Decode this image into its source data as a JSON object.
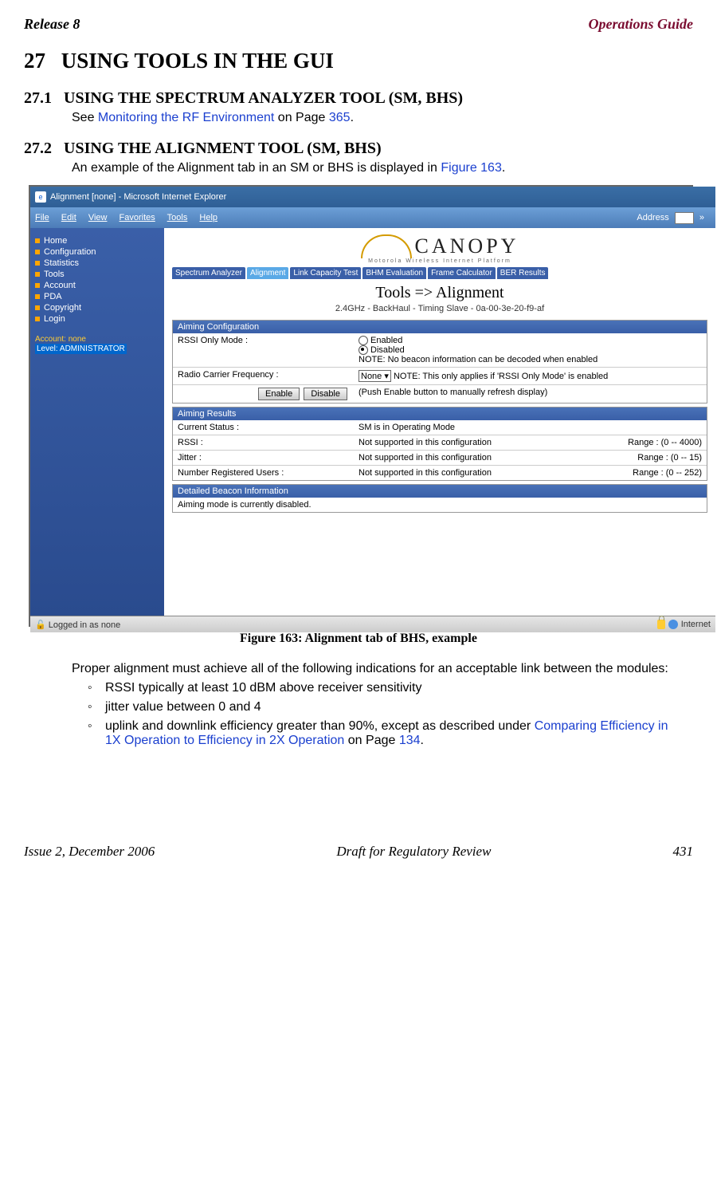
{
  "header": {
    "left": "Release 8",
    "right": "Operations Guide"
  },
  "chapter": {
    "num": "27",
    "title": "USING TOOLS IN THE GUI"
  },
  "s1": {
    "num": "27.1",
    "title": "USING THE SPECTRUM ANALYZER TOOL (SM, BHS)",
    "text_pre": "See ",
    "link": "Monitoring the RF Environment",
    "text_mid": " on Page ",
    "pg": "365",
    "text_post": "."
  },
  "s2": {
    "num": "27.2",
    "title": "USING THE ALIGNMENT TOOL (SM, BHS)",
    "text_pre": "An example of the Alignment tab in an SM or BHS is displayed in ",
    "link": "Figure 163",
    "text_post": "."
  },
  "figure": {
    "caption": "Figure 163: Alignment tab of BHS, example",
    "titlebar": "Alignment [none] - Microsoft Internet Explorer",
    "menus": [
      "File",
      "Edit",
      "View",
      "Favorites",
      "Tools",
      "Help"
    ],
    "address_label": "Address",
    "sidebar": {
      "items": [
        "Home",
        "Configuration",
        "Statistics",
        "Tools",
        "Account",
        "PDA",
        "Copyright",
        "Login"
      ],
      "acct1": "Account: none",
      "acct2": "Level: ADMINISTRATOR"
    },
    "logo": {
      "text": "CANOPY",
      "sub": "Motorola Wireless Internet Platform"
    },
    "tabs": [
      "Spectrum Analyzer",
      "Alignment",
      "Link Capacity Test",
      "BHM Evaluation",
      "Frame Calculator",
      "BER Results"
    ],
    "active_tab": 1,
    "page_title": "Tools => Alignment",
    "page_sub": "2.4GHz - BackHaul - Timing Slave - 0a-00-3e-20-f9-af",
    "aiming_cfg": {
      "hdr": "Aiming Configuration",
      "rssi_label": "RSSI Only Mode :",
      "opt_enabled": "Enabled",
      "opt_disabled": "Disabled",
      "note": "NOTE: No beacon information can be decoded when enabled",
      "radio_label": "Radio Carrier Frequency :",
      "radio_value": "None",
      "radio_note": "NOTE: This only applies if 'RSSI Only Mode' is enabled",
      "btn_enable": "Enable",
      "btn_disable": "Disable",
      "btn_note": "(Push Enable button to manually refresh display)"
    },
    "aiming_res": {
      "hdr": "Aiming Results",
      "rows": [
        {
          "l": "Current Status :",
          "v": "SM is in Operating Mode",
          "r": ""
        },
        {
          "l": "RSSI :",
          "v": "Not supported in this configuration",
          "r": "Range : (0 -- 4000)"
        },
        {
          "l": "Jitter :",
          "v": "Not supported in this configuration",
          "r": "Range : (0 -- 15)"
        },
        {
          "l": "Number Registered Users :",
          "v": "Not supported in this configuration",
          "r": "Range : (0 -- 252)"
        }
      ]
    },
    "beacon": {
      "hdr": "Detailed Beacon Information",
      "text": "Aiming mode is currently disabled."
    },
    "status_left": "Logged in as none",
    "status_right": "Internet"
  },
  "after_fig": "Proper alignment must achieve all of the following indications for an acceptable link between the modules:",
  "bullets": {
    "b1": "RSSI typically at least 10 dBM above receiver sensitivity",
    "b2": "jitter value between 0 and 4",
    "b3_pre": "uplink and downlink efficiency greater than 90%, except as described under ",
    "b3_link": "Comparing Efficiency in 1X Operation to Efficiency in 2X Operation",
    "b3_mid": " on Page ",
    "b3_pg": "134",
    "b3_post": "."
  },
  "footer": {
    "left": "Issue 2, December 2006",
    "mid": "Draft for Regulatory Review",
    "right": "431"
  }
}
